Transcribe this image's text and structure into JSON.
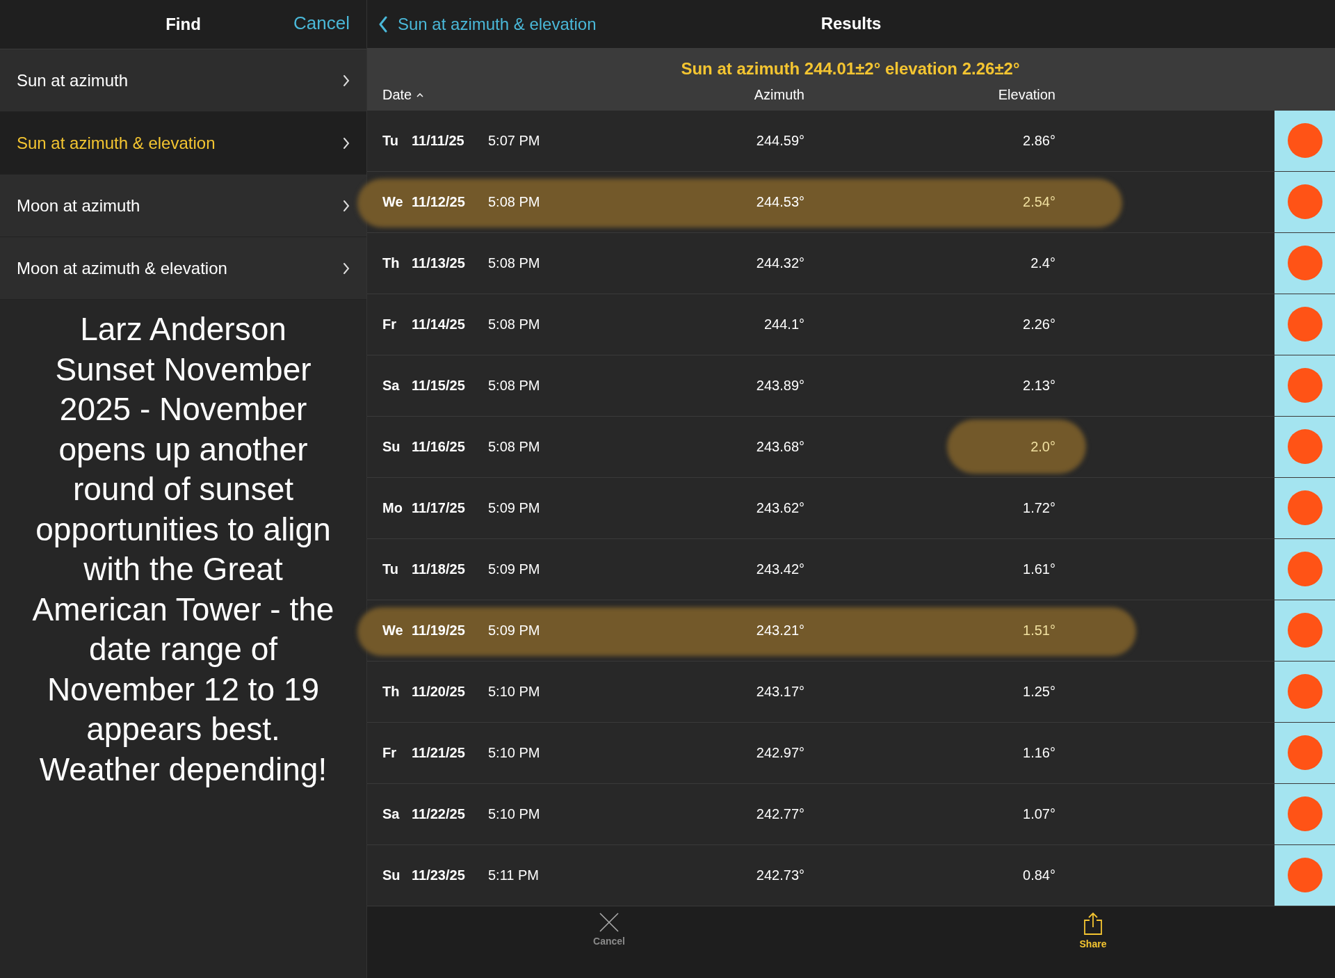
{
  "sidebar": {
    "title": "Find",
    "cancel": "Cancel",
    "items": [
      {
        "label": "Sun at azimuth",
        "selected": false
      },
      {
        "label": "Sun at azimuth & elevation",
        "selected": true
      },
      {
        "label": "Moon at azimuth",
        "selected": false
      },
      {
        "label": "Moon at azimuth & elevation",
        "selected": false
      }
    ],
    "note": "Larz Anderson Sunset November 2025 - November opens up another round of sunset opportunities to align with the Great American Tower - the date range of November 12 to 19 appears best. Weather depending!"
  },
  "header": {
    "back": "Sun at azimuth & elevation",
    "title": "Results"
  },
  "query": "Sun at azimuth 244.01±2° elevation 2.26±2°",
  "table": {
    "columns": [
      "Date",
      "Azimuth",
      "Elevation"
    ],
    "rows": [
      {
        "day": "Tu",
        "date": "11/11/25",
        "time": "5:07 PM",
        "azimuth": "244.59°",
        "elevation": "2.86°",
        "highlighted": false,
        "elevation_highlighted": false
      },
      {
        "day": "We",
        "date": "11/12/25",
        "time": "5:08 PM",
        "azimuth": "244.53°",
        "elevation": "2.54°",
        "highlighted": true,
        "elevation_highlighted": false
      },
      {
        "day": "Th",
        "date": "11/13/25",
        "time": "5:08 PM",
        "azimuth": "244.32°",
        "elevation": "2.4°",
        "highlighted": false,
        "elevation_highlighted": false
      },
      {
        "day": "Fr",
        "date": "11/14/25",
        "time": "5:08 PM",
        "azimuth": "244.1°",
        "elevation": "2.26°",
        "highlighted": false,
        "elevation_highlighted": false
      },
      {
        "day": "Sa",
        "date": "11/15/25",
        "time": "5:08 PM",
        "azimuth": "243.89°",
        "elevation": "2.13°",
        "highlighted": false,
        "elevation_highlighted": false
      },
      {
        "day": "Su",
        "date": "11/16/25",
        "time": "5:08 PM",
        "azimuth": "243.68°",
        "elevation": "2.0°",
        "highlighted": false,
        "elevation_highlighted": true
      },
      {
        "day": "Mo",
        "date": "11/17/25",
        "time": "5:09 PM",
        "azimuth": "243.62°",
        "elevation": "1.72°",
        "highlighted": false,
        "elevation_highlighted": false
      },
      {
        "day": "Tu",
        "date": "11/18/25",
        "time": "5:09 PM",
        "azimuth": "243.42°",
        "elevation": "1.61°",
        "highlighted": false,
        "elevation_highlighted": false
      },
      {
        "day": "We",
        "date": "11/19/25",
        "time": "5:09 PM",
        "azimuth": "243.21°",
        "elevation": "1.51°",
        "highlighted": true,
        "elevation_highlighted": false
      },
      {
        "day": "Th",
        "date": "11/20/25",
        "time": "5:10 PM",
        "azimuth": "243.17°",
        "elevation": "1.25°",
        "highlighted": false,
        "elevation_highlighted": false
      },
      {
        "day": "Fr",
        "date": "11/21/25",
        "time": "5:10 PM",
        "azimuth": "242.97°",
        "elevation": "1.16°",
        "highlighted": false,
        "elevation_highlighted": false
      },
      {
        "day": "Sa",
        "date": "11/22/25",
        "time": "5:10 PM",
        "azimuth": "242.77°",
        "elevation": "1.07°",
        "highlighted": false,
        "elevation_highlighted": false
      },
      {
        "day": "Su",
        "date": "11/23/25",
        "time": "5:11 PM",
        "azimuth": "242.73°",
        "elevation": "0.84°",
        "highlighted": false,
        "elevation_highlighted": false
      }
    ]
  },
  "toolbar": {
    "cancel": "Cancel",
    "share": "Share"
  }
}
